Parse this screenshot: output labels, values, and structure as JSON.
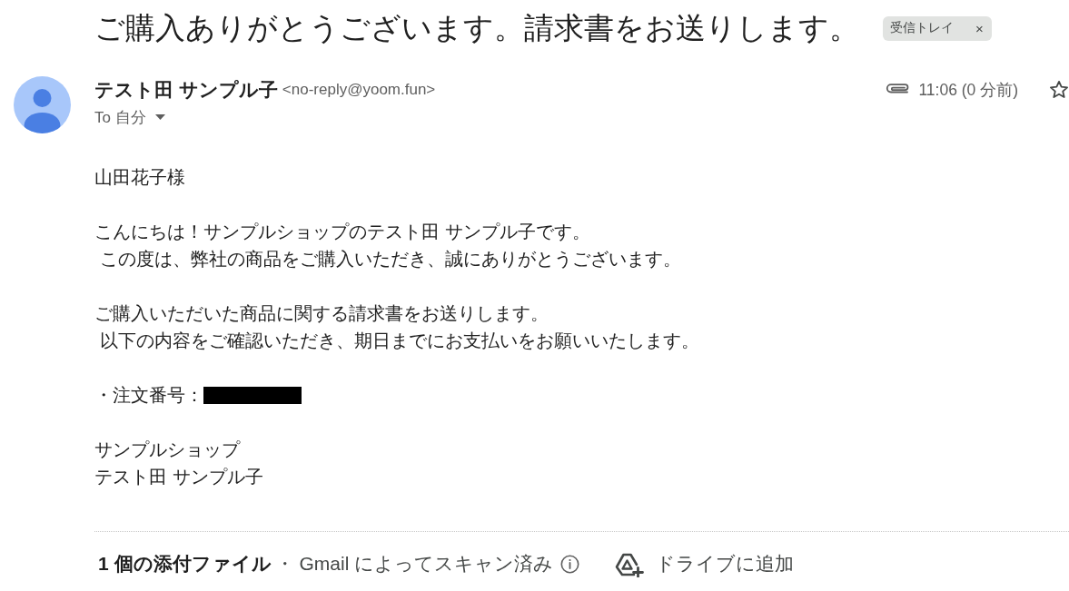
{
  "subject": "ご購入ありがとうございます。請求書をお送りします。",
  "labels": [
    {
      "text": "受信トレイ",
      "remove": "×"
    }
  ],
  "sender": {
    "name": "テスト田 サンプル子",
    "email": "<no-reply@yoom.fun>"
  },
  "recipient": "To 自分",
  "message_meta": {
    "has_attachment": true,
    "time": "11:06 (0 分前)",
    "starred": false
  },
  "body": [
    {
      "lines": [
        "山田花子様"
      ],
      "redacted": false
    },
    {
      "lines": [
        "こんにちは！サンプルショップのテスト田 サンプル子です。",
        " この度は、弊社の商品をご購入いただき、誠にありがとうございます。"
      ],
      "redacted": false
    },
    {
      "lines": [
        "ご購入いただいた商品に関する請求書をお送りします。",
        " 以下の内容をご確認いただき、期日までにお支払いをお願いいたします。"
      ],
      "redacted": false
    },
    {
      "lines": [
        "・注文番号："
      ],
      "redacted": true
    },
    {
      "lines": [
        "サンプルショップ",
        "テスト田 サンプル子"
      ],
      "redacted": false
    }
  ],
  "attachments": {
    "count_label": "1 個の添付ファイル",
    "separator": "・",
    "scan_note": "Gmail によってスキャン済み",
    "drive_action": "ドライブに追加"
  }
}
